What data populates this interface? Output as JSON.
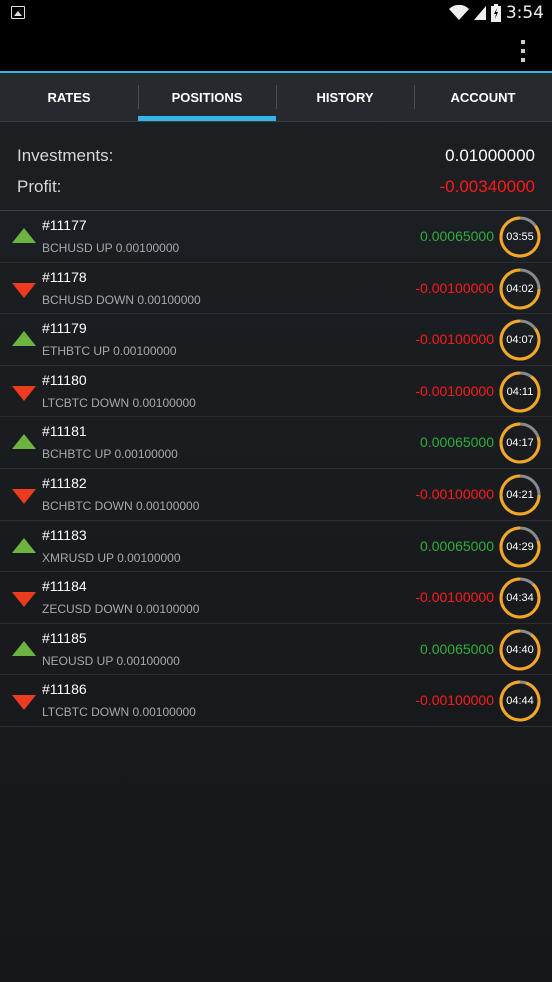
{
  "status_bar": {
    "time": "3:54"
  },
  "colors": {
    "positive": "#2fae3a",
    "negative": "#ff1a1a",
    "accent": "#33b5e5",
    "timer_ring": "#f5a623",
    "timer_track": "#8a8a8a"
  },
  "tabs": [
    {
      "label": "RATES",
      "active": false
    },
    {
      "label": "POSITIONS",
      "active": true
    },
    {
      "label": "HISTORY",
      "active": false
    },
    {
      "label": "ACCOUNT",
      "active": false
    }
  ],
  "summary": {
    "investments_label": "Investments:",
    "investments_value": "0.01000000",
    "profit_label": "Profit:",
    "profit_value": "-0.00340000"
  },
  "positions": [
    {
      "id": "#11177",
      "desc": "BCHUSD UP 0.00100000",
      "direction": "up",
      "value": "0.00065000",
      "time": "03:55",
      "progress": 0.85
    },
    {
      "id": "#11178",
      "desc": "BCHUSD DOWN 0.00100000",
      "direction": "down",
      "value": "-0.00100000",
      "time": "04:02",
      "progress": 0.75
    },
    {
      "id": "#11179",
      "desc": "ETHBTC UP 0.00100000",
      "direction": "up",
      "value": "-0.00100000",
      "time": "04:07",
      "progress": 0.85
    },
    {
      "id": "#11180",
      "desc": "LTCBTC DOWN 0.00100000",
      "direction": "down",
      "value": "-0.00100000",
      "time": "04:11",
      "progress": 0.9
    },
    {
      "id": "#11181",
      "desc": "BCHBTC UP 0.00100000",
      "direction": "up",
      "value": "0.00065000",
      "time": "04:17",
      "progress": 0.8
    },
    {
      "id": "#11182",
      "desc": "BCHBTC DOWN 0.00100000",
      "direction": "down",
      "value": "-0.00100000",
      "time": "04:21",
      "progress": 0.75
    },
    {
      "id": "#11183",
      "desc": "XMRUSD UP 0.00100000",
      "direction": "up",
      "value": "0.00065000",
      "time": "04:29",
      "progress": 0.8
    },
    {
      "id": "#11184",
      "desc": "ZECUSD DOWN 0.00100000",
      "direction": "down",
      "value": "-0.00100000",
      "time": "04:34",
      "progress": 0.88
    },
    {
      "id": "#11185",
      "desc": "NEOUSD UP 0.00100000",
      "direction": "up",
      "value": "0.00065000",
      "time": "04:40",
      "progress": 0.9
    },
    {
      "id": "#11186",
      "desc": "LTCBTC DOWN 0.00100000",
      "direction": "down",
      "value": "-0.00100000",
      "time": "04:44",
      "progress": 0.95
    }
  ]
}
